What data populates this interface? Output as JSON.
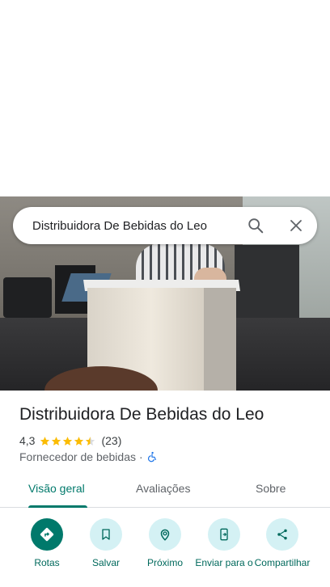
{
  "search": {
    "query": "Distribuidora De Bebidas do Leo"
  },
  "place": {
    "title": "Distribuidora De Bebidas do Leo",
    "rating": "4,3",
    "stars": 4.3,
    "review_count": "(23)",
    "category": "Fornecedor de bebidas",
    "separator": "·"
  },
  "tabs": [
    {
      "label": "Visão geral",
      "active": true
    },
    {
      "label": "Avaliações",
      "active": false
    },
    {
      "label": "Sobre",
      "active": false
    }
  ],
  "actions": [
    {
      "label": "Rotas",
      "icon": "directions-icon"
    },
    {
      "label": "Salvar",
      "icon": "bookmark-icon"
    },
    {
      "label": "Próximo",
      "icon": "nearby-icon"
    },
    {
      "label": "Enviar para o",
      "icon": "send-to-phone-icon"
    },
    {
      "label": "Compartilhar",
      "icon": "share-icon"
    }
  ],
  "colors": {
    "accent": "#00796b",
    "accent_light": "#d4f1f4",
    "star": "#fbbc04",
    "accessibility": "#1a73e8"
  }
}
